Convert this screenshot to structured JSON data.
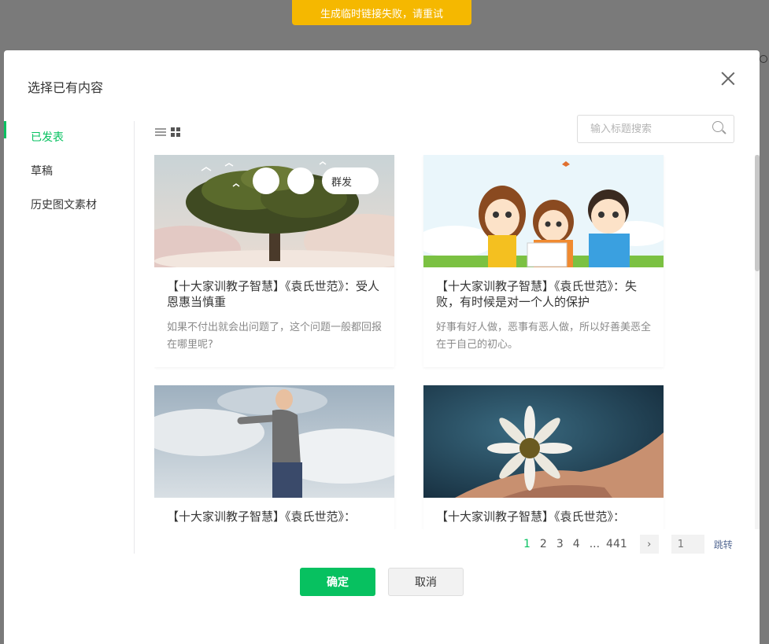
{
  "toast": {
    "message": "生成临时链接失败，请重试"
  },
  "modal": {
    "title": "选择已有内容",
    "sidebar": [
      {
        "label": "已发表",
        "active": true
      },
      {
        "label": "草稿",
        "active": false
      },
      {
        "label": "历史图文素材",
        "active": false
      }
    ],
    "search": {
      "placeholder": "输入标题搜索"
    },
    "cards": [
      {
        "title": "【十大家训教子智慧】《袁氏世范》：受人恩惠当慎重",
        "desc": "如果不付出就会出问题了，这个问题一般都回报在哪里呢?",
        "image": "tree-in-clouds-image"
      },
      {
        "title": "【十大家训教子智慧】《袁氏世范》：失败，有时候是对一个人的保护",
        "desc": "好事有好人做，恶事有恶人做，所以好善美恶全在于自己的初心。",
        "image": "cartoon-children-image"
      },
      {
        "title": "【十大家训教子智慧】《袁氏世范》：",
        "desc": "",
        "image": "man-open-arms-sky-image"
      },
      {
        "title": "【十大家训教子智慧】《袁氏世范》：",
        "desc": "",
        "image": "daisy-in-hand-image"
      }
    ],
    "hover_actions": {
      "mass_send_label": "群发"
    },
    "pagination": {
      "pages": [
        "1",
        "2",
        "3",
        "4"
      ],
      "ellipsis": "...",
      "last": "441",
      "next_icon": "›",
      "jump_placeholder": "1",
      "jump_label": "跳转"
    },
    "buttons": {
      "confirm": "确定",
      "cancel": "取消"
    }
  },
  "colors": {
    "accent": "#07c160",
    "toast": "#f5b800",
    "link": "#576b95"
  }
}
